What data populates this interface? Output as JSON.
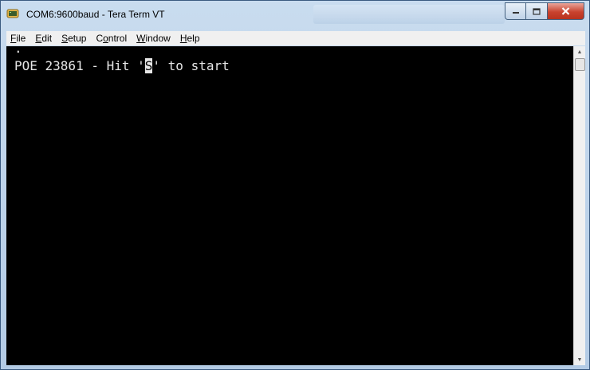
{
  "window": {
    "title": "COM6:9600baud - Tera Term VT",
    "icons": {
      "app": "tera-term-icon",
      "minimize": "minimize-icon",
      "maximize": "maximize-icon",
      "close": "close-icon"
    }
  },
  "menu": [
    {
      "pre": "",
      "key": "F",
      "post": "ile"
    },
    {
      "pre": "",
      "key": "E",
      "post": "dit"
    },
    {
      "pre": "",
      "key": "S",
      "post": "etup"
    },
    {
      "pre": "C",
      "key": "o",
      "post": "ntrol"
    },
    {
      "pre": "",
      "key": "W",
      "post": "indow"
    },
    {
      "pre": "",
      "key": "H",
      "post": "elp"
    }
  ],
  "terminal": {
    "line0": ".",
    "line1_before": "POE 23861 - Hit '",
    "cursor_char": "S",
    "line1_after": "' to start",
    "colors": {
      "background": "#000000",
      "foreground": "#e6e6e6"
    }
  }
}
